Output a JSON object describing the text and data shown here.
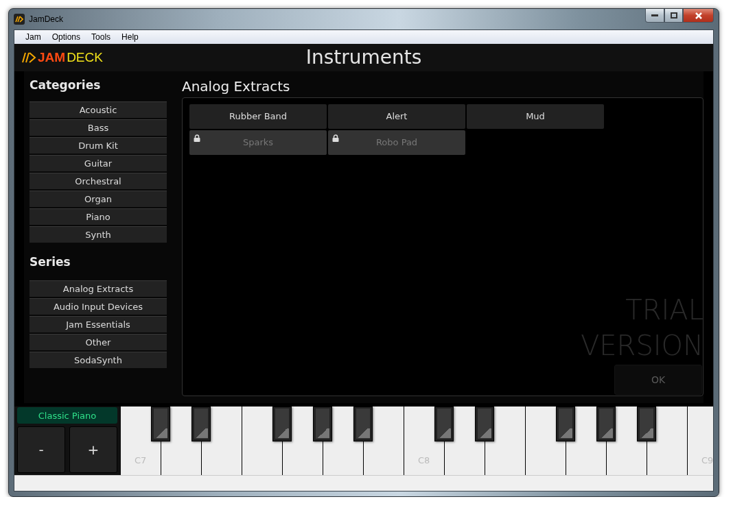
{
  "window": {
    "title": "JamDeck"
  },
  "menu": [
    "Jam",
    "Options",
    "Tools",
    "Help"
  ],
  "logo": {
    "bold": "JAM",
    "light": "DECK"
  },
  "page_title": "Instruments",
  "sidebar": {
    "categories_heading": "Categories",
    "categories": [
      "Acoustic",
      "Bass",
      "Drum Kit",
      "Guitar",
      "Orchestral",
      "Organ",
      "Piano",
      "Synth"
    ],
    "series_heading": "Series",
    "series": [
      "Analog Extracts",
      "Audio Input Devices",
      "Jam Essentials",
      "Other",
      "SodaSynth"
    ]
  },
  "content": {
    "heading": "Analog Extracts",
    "instruments": [
      {
        "name": "Rubber Band",
        "locked": false
      },
      {
        "name": "Alert",
        "locked": false
      },
      {
        "name": "Mud",
        "locked": false
      },
      {
        "name": "Sparks",
        "locked": true
      },
      {
        "name": "Robo Pad",
        "locked": true
      }
    ],
    "trial_lines": [
      "TRIAL",
      "VERSION"
    ],
    "ok_button": "OK"
  },
  "instrument_display": "Classic Piano",
  "octave_buttons": [
    "-",
    "+"
  ],
  "keyboard": {
    "labels": [
      "C7",
      "C8",
      "C9"
    ]
  }
}
